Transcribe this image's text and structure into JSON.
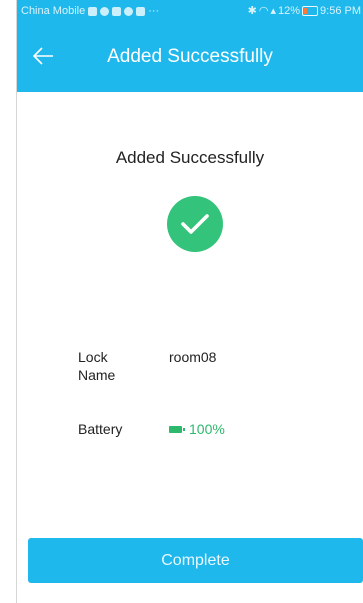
{
  "status_bar": {
    "carrier": "China Mobile",
    "battery_percent": "12%",
    "time": "9:56 PM"
  },
  "app_bar": {
    "title": "Added Successfully"
  },
  "content": {
    "title": "Added Successfully"
  },
  "info": {
    "lock_name_label": "Lock Name",
    "lock_name_value": "room08",
    "battery_label": "Battery",
    "battery_value": "100%"
  },
  "footer": {
    "complete_label": "Complete"
  },
  "colors": {
    "accent": "#1fb8ec",
    "success": "#34c37a",
    "battery_ok": "#2db96c"
  },
  "icons": {
    "back": "arrow-left-icon",
    "success": "check-circle-icon",
    "battery": "battery-icon"
  }
}
